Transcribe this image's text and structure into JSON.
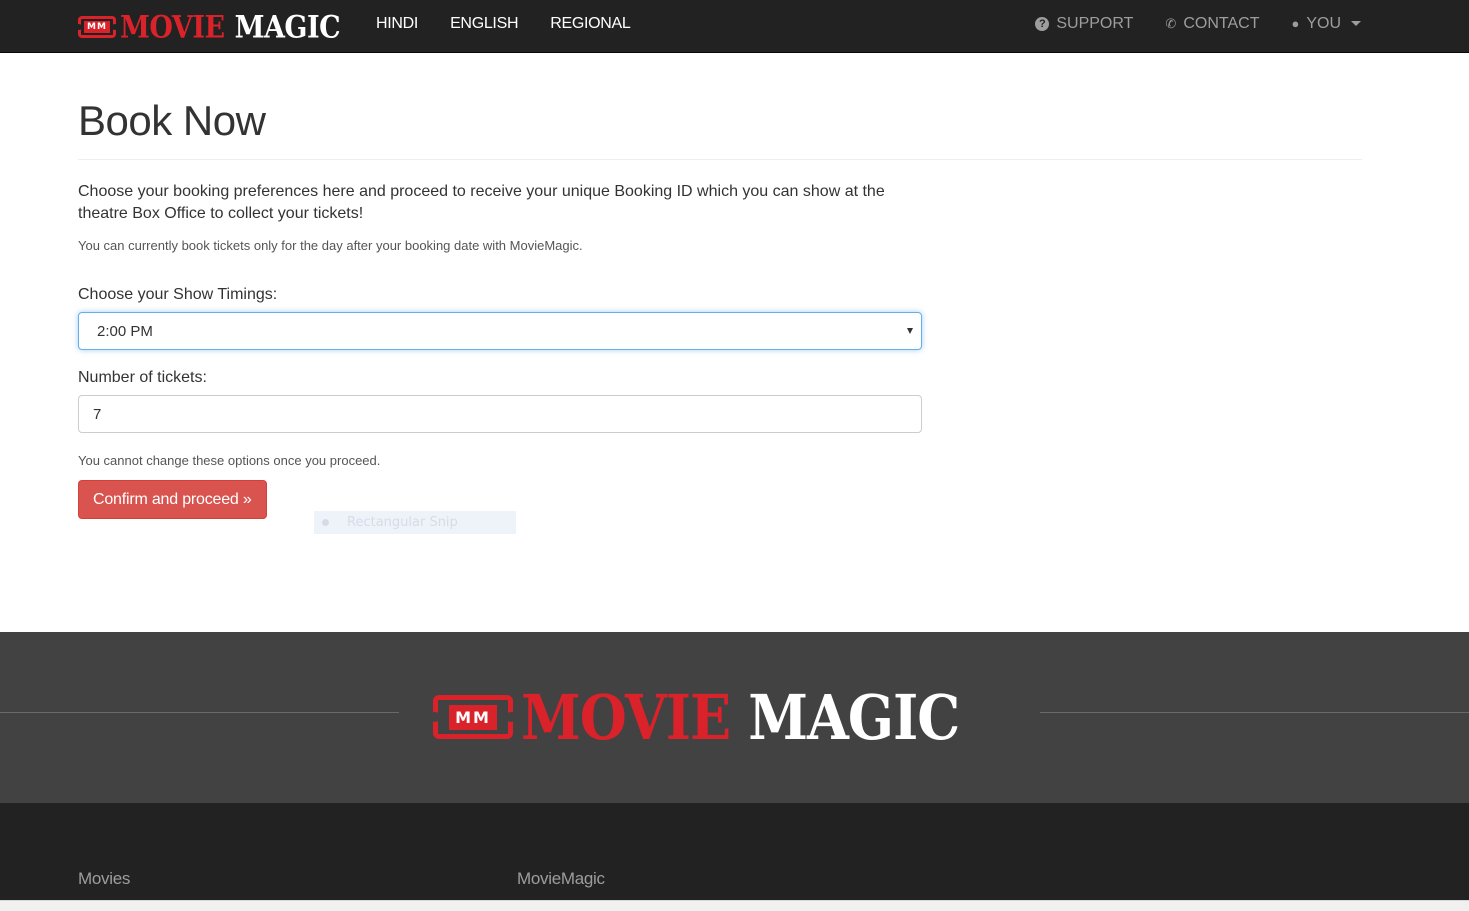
{
  "brand": {
    "red": "MOVIE",
    "white": "MAGIC",
    "ticket": "MM"
  },
  "nav": {
    "left": [
      "HINDI",
      "ENGLISH",
      "REGIONAL"
    ],
    "support": "SUPPORT",
    "contact": "CONTACT",
    "user": "YOU"
  },
  "page": {
    "title": "Book Now",
    "lead": "Choose your booking preferences here and proceed to receive your unique Booking ID which you can show at the theatre Box Office to collect your tickets!",
    "note": "You can currently book tickets only for the day after your booking date with MovieMagic.",
    "show_label": "Choose your Show Timings:",
    "show_value": "2:00 PM",
    "tickets_label": "Number of tickets:",
    "tickets_value": "7",
    "help": "You cannot change these options once you proceed.",
    "button": "Confirm and proceed »"
  },
  "overlay": {
    "snip": "Rectangular Snip"
  },
  "footer": {
    "col1": "Movies",
    "col2": "MovieMagic"
  },
  "colors": {
    "navbar": "#222222",
    "accent": "#d9534f",
    "brand_red": "#d9222a",
    "footer_mid": "#424242"
  }
}
